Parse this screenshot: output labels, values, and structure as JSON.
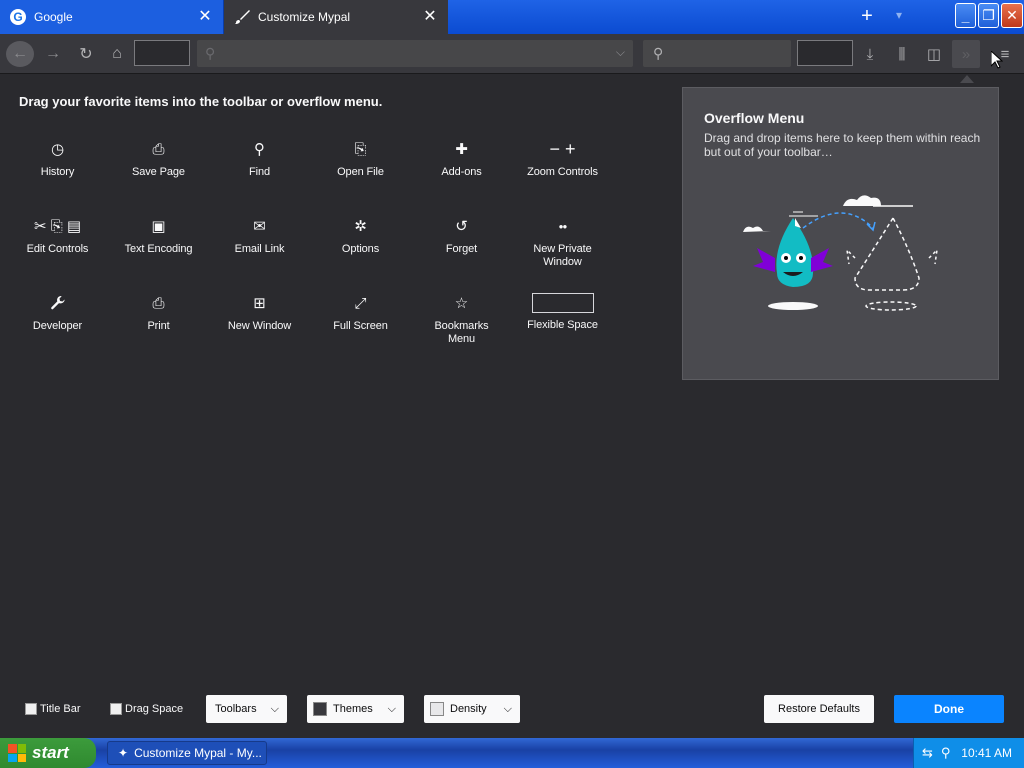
{
  "tabs": [
    {
      "title": "Google",
      "favicon": "google-g-icon",
      "active": false
    },
    {
      "title": "Customize Mypal",
      "favicon": "brush-icon",
      "active": true
    }
  ],
  "tab_close_glyph": "✕",
  "new_tab_glyph": "+",
  "heading": "Drag your favorite items into the toolbar or overflow menu.",
  "palette": [
    {
      "label": "History",
      "icon": "clock-icon",
      "glyph": "◷"
    },
    {
      "label": "Save Page",
      "icon": "save-page-icon",
      "glyph": "⎙"
    },
    {
      "label": "Find",
      "icon": "search-icon",
      "glyph": "⚲"
    },
    {
      "label": "Open File",
      "icon": "open-file-icon",
      "glyph": "⎘"
    },
    {
      "label": "Add-ons",
      "icon": "puzzle-icon",
      "glyph": "✚"
    },
    {
      "label": "Zoom Controls",
      "icon": "zoom-icon",
      "glyph": "− +"
    },
    {
      "label": "Edit Controls",
      "icon": "edit-controls-icon",
      "glyph": "✂ ⎘ ▤"
    },
    {
      "label": "Text Encoding",
      "icon": "text-encoding-icon",
      "glyph": "▣"
    },
    {
      "label": "Email Link",
      "icon": "email-icon",
      "glyph": "✉"
    },
    {
      "label": "Options",
      "icon": "gear-icon",
      "glyph": "✲"
    },
    {
      "label": "Forget",
      "icon": "forget-icon",
      "glyph": "↺"
    },
    {
      "label": "New Private\nWindow",
      "icon": "mask-icon",
      "glyph": "●●"
    },
    {
      "label": "Developer",
      "icon": "wrench-icon",
      "glyph": "🔧"
    },
    {
      "label": "Print",
      "icon": "print-icon",
      "glyph": "⎙"
    },
    {
      "label": "New Window",
      "icon": "new-window-icon",
      "glyph": "⊞"
    },
    {
      "label": "Full Screen",
      "icon": "fullscreen-icon",
      "glyph": "⤢"
    },
    {
      "label": "Bookmarks\nMenu",
      "icon": "bookmark-star-icon",
      "glyph": "☆"
    },
    {
      "label": "Flexible Space",
      "icon": "flexible-space-box",
      "glyph": ""
    }
  ],
  "overflow": {
    "title": "Overflow Menu",
    "description": "Drag and drop items here to keep them within reach but out of your toolbar…"
  },
  "footer": {
    "title_bar": "Title Bar",
    "drag_space": "Drag Space",
    "toolbars": "Toolbars",
    "themes": "Themes",
    "density": "Density",
    "restore": "Restore Defaults",
    "done": "Done"
  },
  "taskbar": {
    "start": "start",
    "task_item": "Customize Mypal - My...",
    "clock": "10:41 AM"
  },
  "colors": {
    "accent": "#0a84ff",
    "background": "#2a2a2e",
    "panel": "#4a4a4f"
  }
}
